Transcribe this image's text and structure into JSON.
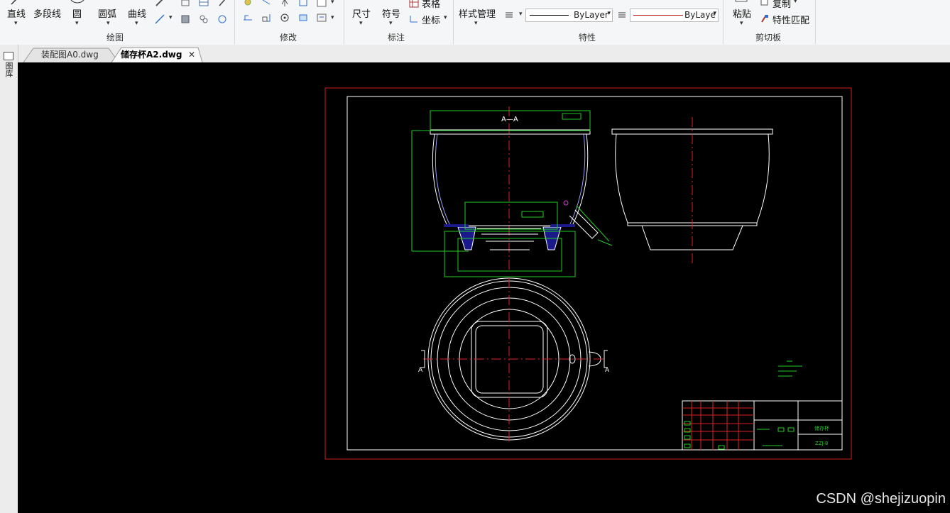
{
  "ribbon": {
    "draw": {
      "line": "直线",
      "polyline": "多段线",
      "circle": "圆",
      "arc": "圆弧",
      "curve": "曲线",
      "group": "绘图"
    },
    "modify": {
      "group": "修改"
    },
    "annotate": {
      "dimension": "尺寸",
      "symbol": "符号",
      "table": "表格",
      "coordinate": "坐标",
      "group": "标注"
    },
    "properties": {
      "style_manager": "样式管理",
      "linetype": "ByLayer",
      "color": "ByLaye",
      "group": "特性"
    },
    "clipboard": {
      "paste": "粘贴",
      "copy": "复制",
      "match": "特性匹配",
      "group": "剪切板"
    }
  },
  "tabs": [
    {
      "label": "装配图A0.dwg",
      "active": false
    },
    {
      "label": "储存杯A2.dwg",
      "active": true
    }
  ],
  "left_panel_label": "图库",
  "drawing": {
    "section_label": "A—A",
    "cut_label_left": "A",
    "cut_label_right": "A",
    "title_block": {
      "name": "储存杯",
      "code": "ZZJ-8"
    }
  },
  "watermark": "CSDN @shejizuopin",
  "colors": {
    "canvas": "#000000",
    "frame_border": "#cc1f1f",
    "outline": "#ffffff",
    "dimension": "#22cc22",
    "centerline": "#dd2222",
    "section_fill": "#1a1a8c"
  }
}
